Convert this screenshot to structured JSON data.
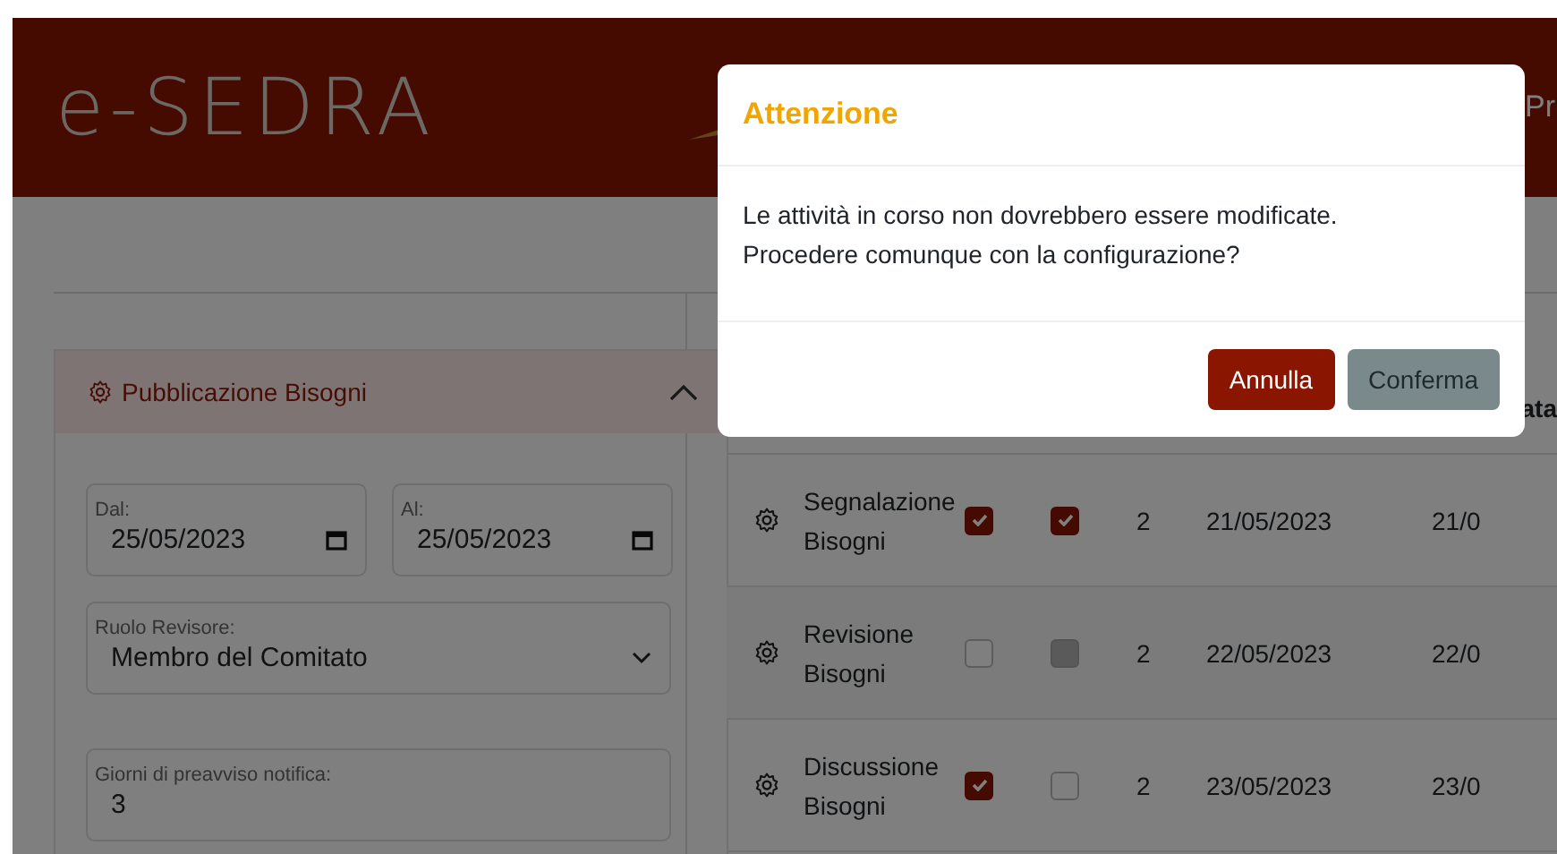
{
  "header": {
    "logo": "e-SEDRA",
    "nav_partial": "Pr"
  },
  "panel": {
    "title": "Pubblicazione Bisogni",
    "expanded": true,
    "date_from": {
      "label": "Dal:",
      "value": "25/05/2023"
    },
    "date_to": {
      "label": "Al:",
      "value": "25/05/2023"
    },
    "role": {
      "label": "Ruolo Revisore:",
      "value": "Membro del Comitato"
    },
    "notice_days": {
      "label": "Giorni di preavviso notifica:",
      "value": "3"
    }
  },
  "table": {
    "columns": [
      {
        "label": "ata"
      }
    ],
    "rows": [
      {
        "name": "Segnalazione Bisogni",
        "check_1": {
          "checked": true,
          "disabled": false
        },
        "check_2": {
          "checked": true,
          "disabled": false
        },
        "count": "2",
        "start": "21/05/2023",
        "end": "21/0"
      },
      {
        "name": "Revisione Bisogni",
        "check_1": {
          "checked": false,
          "disabled": false
        },
        "check_2": {
          "checked": false,
          "disabled": true
        },
        "count": "2",
        "start": "22/05/2023",
        "end": "22/0"
      },
      {
        "name": "Discussione Bisogni",
        "check_1": {
          "checked": true,
          "disabled": false
        },
        "check_2": {
          "checked": false,
          "disabled": false
        },
        "count": "2",
        "start": "23/05/2023",
        "end": "23/0"
      }
    ]
  },
  "dialog": {
    "title": "Attenzione",
    "lines": [
      "Le attività in corso non dovrebbero essere modificate.",
      "Procedere comunque con la configurazione?"
    ],
    "buttons": [
      {
        "label": "Annulla",
        "kind": "danger"
      },
      {
        "label": "Conferma",
        "kind": "secondary"
      }
    ]
  }
}
